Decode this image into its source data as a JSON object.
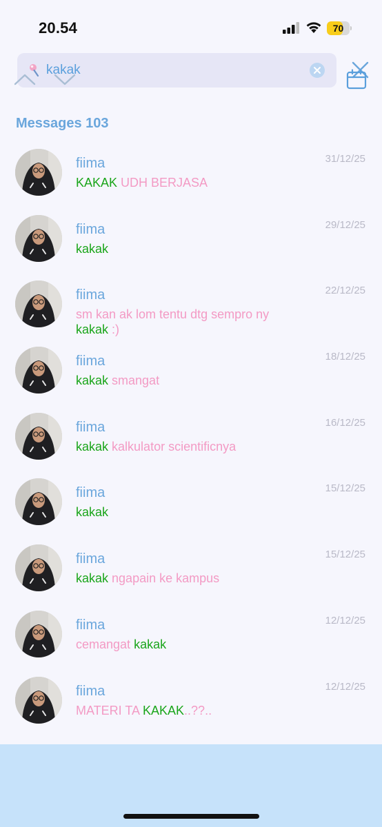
{
  "status_bar": {
    "time": "20.54",
    "battery": "70",
    "battery_level": 0.7
  },
  "search": {
    "query": "kakak"
  },
  "section": {
    "title": "Messages 103"
  },
  "messages": [
    {
      "name": "fiima",
      "date": "31/12/25",
      "parts": [
        {
          "text": "KAKAK",
          "hl": true
        },
        {
          "text": " UDH BERJASA",
          "hl": false
        }
      ]
    },
    {
      "name": "fiima",
      "date": "29/12/25",
      "parts": [
        {
          "text": "kakak",
          "hl": true
        }
      ]
    },
    {
      "name": "fiima",
      "date": "22/12/25",
      "parts": [
        {
          "text": "sm kan ak lom tentu dtg sempro ny ",
          "hl": false
        },
        {
          "text": "kakak",
          "hl": true
        },
        {
          "text": " :)",
          "hl": false
        }
      ]
    },
    {
      "name": "fiima",
      "date": "18/12/25",
      "parts": [
        {
          "text": "kakak",
          "hl": true
        },
        {
          "text": " smangat",
          "hl": false
        }
      ]
    },
    {
      "name": "fiima",
      "date": "16/12/25",
      "parts": [
        {
          "text": "kakak",
          "hl": true
        },
        {
          "text": " kalkulator scientificnya",
          "hl": false
        }
      ]
    },
    {
      "name": "fiima",
      "date": "15/12/25",
      "parts": [
        {
          "text": "kakak",
          "hl": true
        }
      ]
    },
    {
      "name": "fiima",
      "date": "15/12/25",
      "parts": [
        {
          "text": "kakak",
          "hl": true
        },
        {
          "text": " ngapain ke kampus",
          "hl": false
        }
      ]
    },
    {
      "name": "fiima",
      "date": "12/12/25",
      "parts": [
        {
          "text": "cemangat ",
          "hl": false
        },
        {
          "text": "kakak",
          "hl": true
        }
      ]
    },
    {
      "name": "fiima",
      "date": "12/12/25",
      "parts": [
        {
          "text": "MATERI TA ",
          "hl": false
        },
        {
          "text": "KAKAK",
          "hl": true
        },
        {
          "text": "..??..",
          "hl": false
        }
      ]
    }
  ],
  "colors": {
    "accent": "#6aa6dc",
    "highlight": "#1aa51a",
    "message_text": "#f39ac4",
    "bottom_bar": "#c6e2fa"
  },
  "icons": {
    "search": "pin-icon",
    "clear": "clear-circle-icon",
    "close": "close-x-icon",
    "up": "chevron-up-icon",
    "down": "chevron-down-icon",
    "calendar": "calendar-icon"
  }
}
